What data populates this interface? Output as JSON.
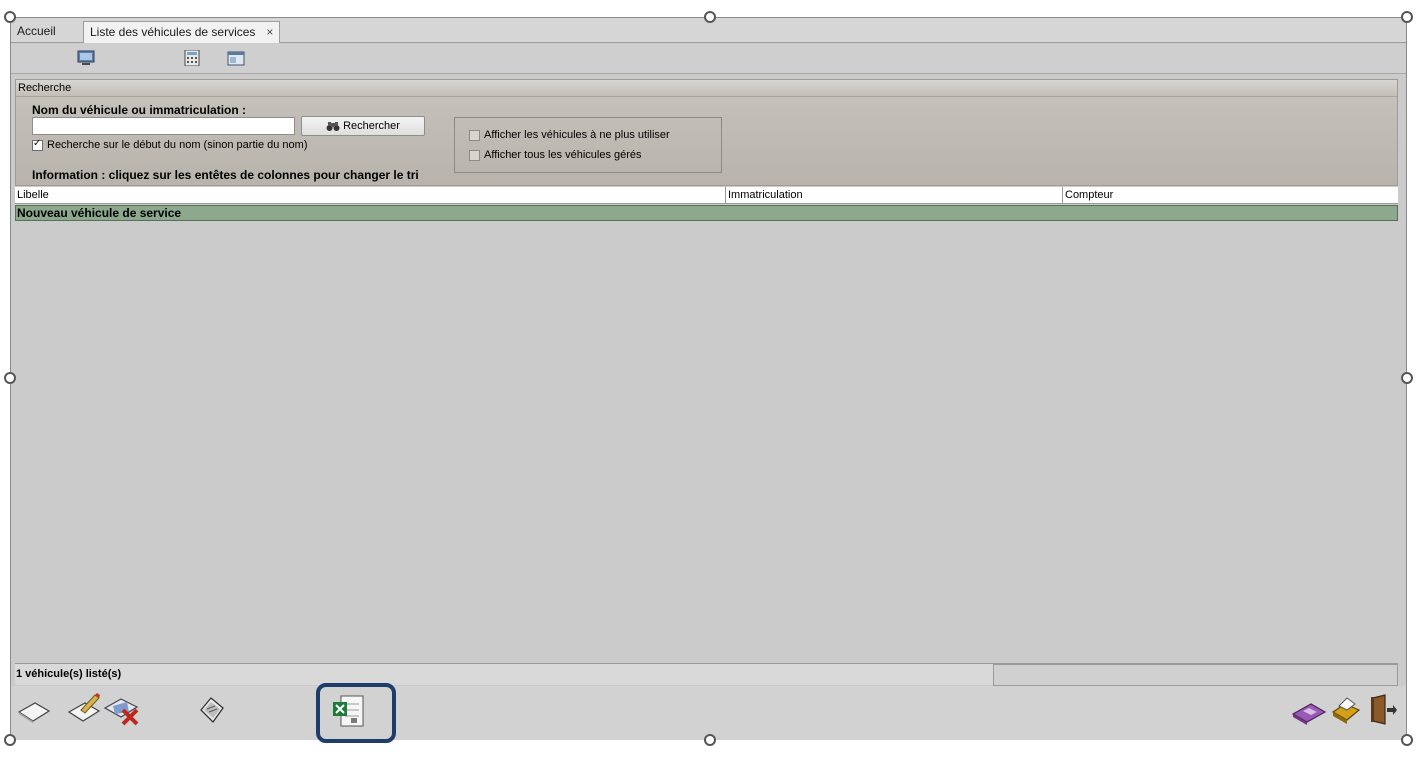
{
  "tabs": {
    "home": "Accueil",
    "list": "Liste des véhicules de services",
    "close": "×"
  },
  "top_toolbar": {
    "icons": [
      "screen-icon",
      "calculator-icon",
      "window-icon"
    ]
  },
  "search": {
    "header": "Recherche",
    "name_label": "Nom du véhicule ou immatriculation :",
    "input_value": "",
    "button_label": "Rechercher",
    "start_of_name": {
      "label": "Recherche sur le début du nom (sinon partie du nom)",
      "checked": true
    },
    "info": "Information : cliquez sur les entêtes de colonnes pour changer le tri",
    "options": [
      {
        "label": "Afficher les véhicules à ne plus utiliser",
        "checked": false
      },
      {
        "label": "Afficher tous les véhicules gérés",
        "checked": false
      }
    ]
  },
  "grid": {
    "columns": [
      "Libelle",
      "Immatriculation",
      "Compteur"
    ],
    "rows": [
      {
        "libelle": "Nouveau véhicule de service",
        "immatriculation": "",
        "compteur": ""
      }
    ],
    "row_color": "#8ca98e"
  },
  "status": {
    "count": "1 véhicule(s) listé(s)"
  },
  "bottom_toolbar": {
    "left_icons": [
      "new-document-icon",
      "edit-document-icon",
      "delete-document-icon",
      "print-preview-icon",
      "excel-export-icon"
    ],
    "right_icons": [
      "purple-card-icon",
      "printer-icon",
      "exit-door-icon"
    ]
  },
  "colors": {
    "highlight": "#1f3d6b",
    "excel_green": "#1d7a3a"
  }
}
